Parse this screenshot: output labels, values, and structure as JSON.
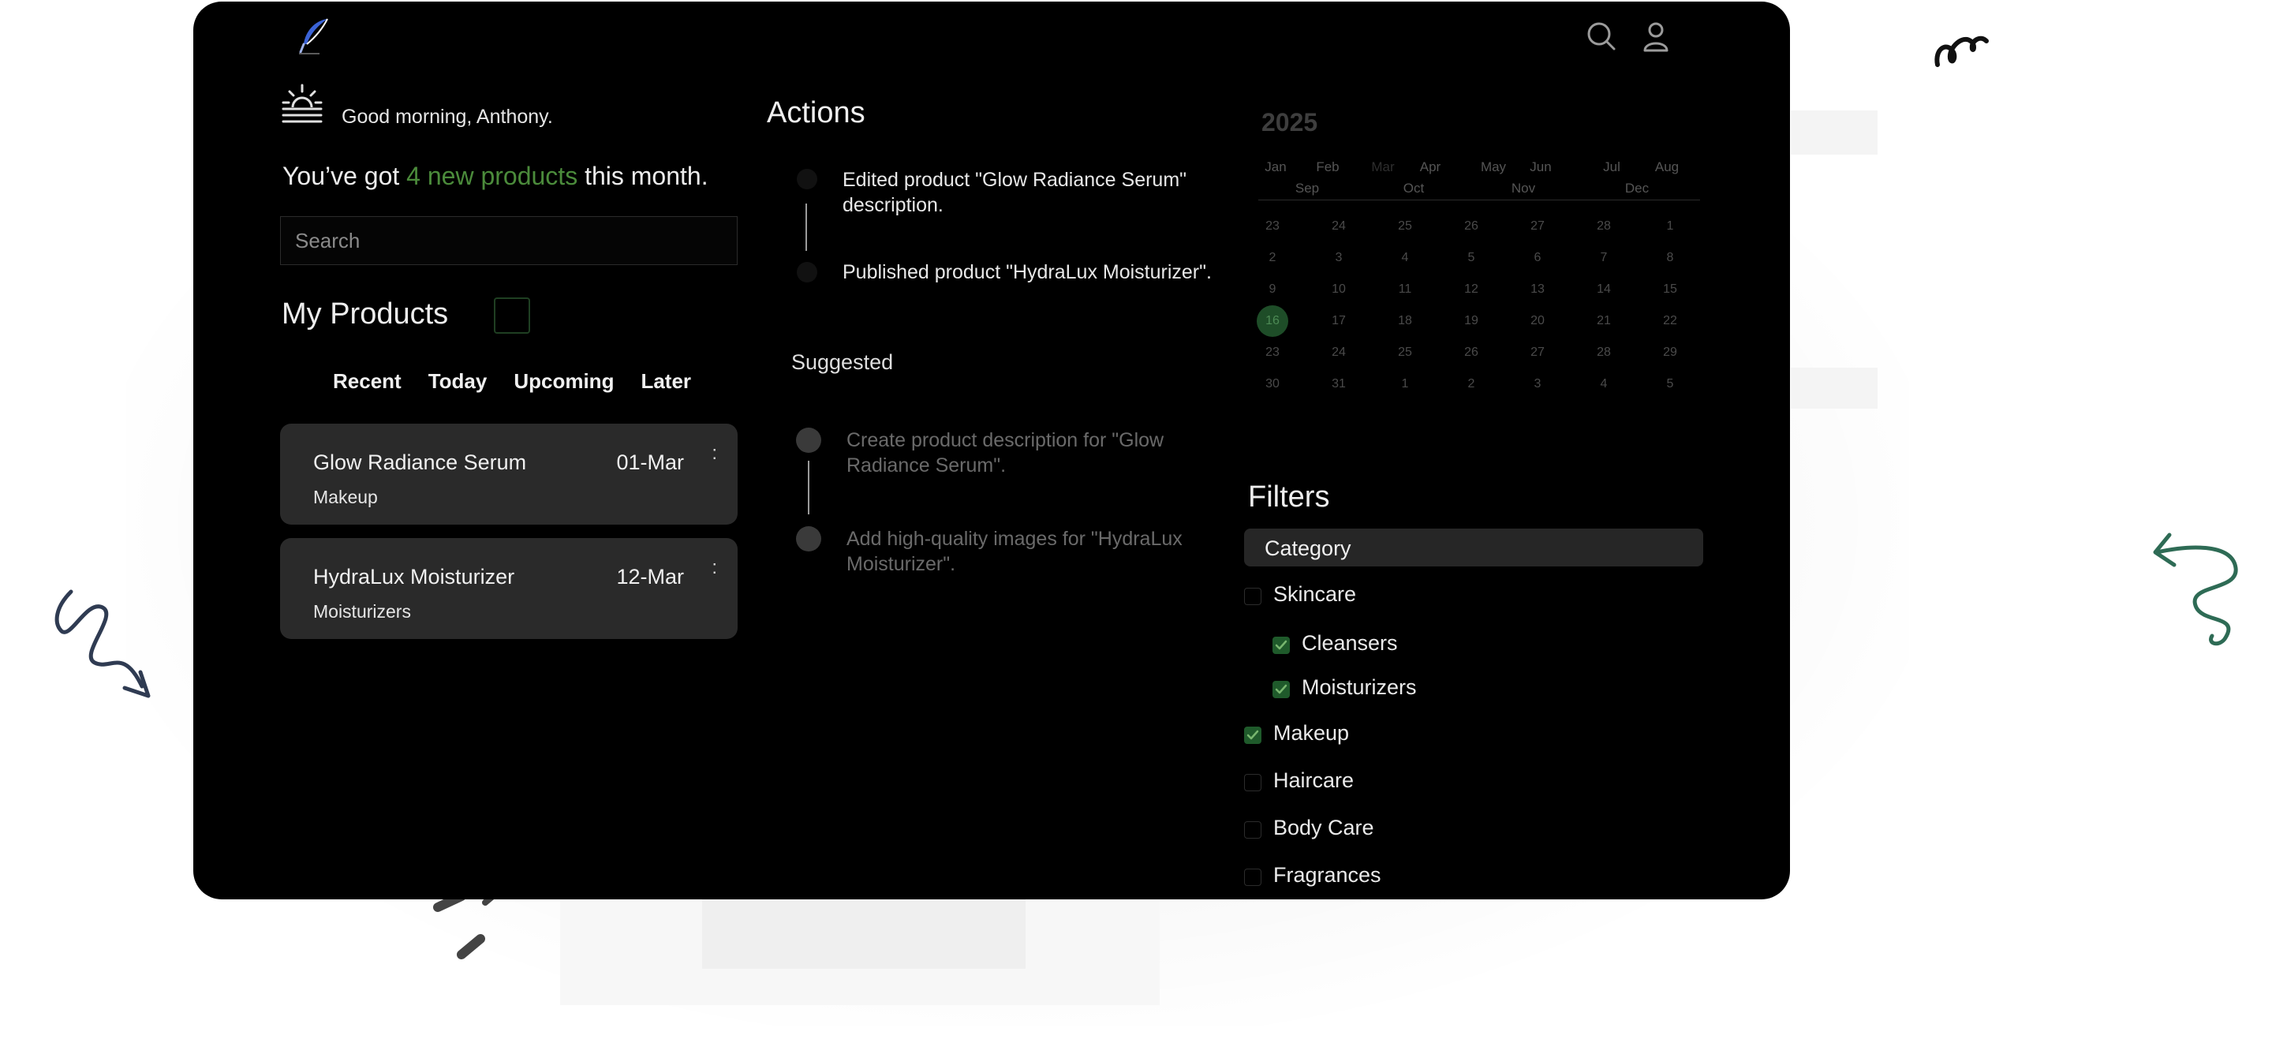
{
  "header": {
    "logo_icon": "feather-quill-icon",
    "search_icon": "search-icon",
    "profile_icon": "user-icon"
  },
  "greeting": {
    "icon": "sunrise-icon",
    "text": "Good morning, Anthony."
  },
  "summary": {
    "prefix": "You’ve got",
    "highlight": "4 new products",
    "suffix": "this month.",
    "highlight_color": "#4b8b3b"
  },
  "search": {
    "placeholder": "Search"
  },
  "products": {
    "title": "My Products",
    "tabs": [
      "Recent",
      "Today",
      "Upcoming",
      "Later"
    ],
    "items": [
      {
        "name": "Glow Radiance Serum",
        "date": "01-Mar",
        "category": "Makeup",
        "menu": ":"
      },
      {
        "name": "HydraLux Moisturizer",
        "date": "12-Mar",
        "category": "Moisturizers",
        "menu": ":"
      }
    ]
  },
  "actions": {
    "title": "Actions",
    "items": [
      "Edited product \"Glow Radiance Serum\" description.",
      "Published product \"HydraLux Moisturizer\"."
    ],
    "suggested_title": "Suggested",
    "suggested": [
      "Create product description for \"Glow Radiance Serum\".",
      "Add high-quality images for \"HydraLux Moisturizer\"."
    ]
  },
  "calendar": {
    "year": "2025",
    "months_row1": [
      "Jan",
      "Feb",
      "Mar",
      "Apr",
      "May",
      "Jun",
      "Jul",
      "Aug"
    ],
    "months_row2": [
      "Sep",
      "Oct",
      "Nov",
      "Dec"
    ],
    "selected_month": "Mar",
    "weeks": [
      [
        "23",
        "24",
        "25",
        "26",
        "27",
        "28",
        "1"
      ],
      [
        "2",
        "3",
        "4",
        "5",
        "6",
        "7",
        "8"
      ],
      [
        "9",
        "10",
        "11",
        "12",
        "13",
        "14",
        "15"
      ],
      [
        "16",
        "17",
        "18",
        "19",
        "20",
        "21",
        "22"
      ],
      [
        "23",
        "24",
        "25",
        "26",
        "27",
        "28",
        "29"
      ],
      [
        "30",
        "31",
        "1",
        "2",
        "3",
        "4",
        "5"
      ]
    ],
    "today": "16"
  },
  "filters": {
    "title": "Filters",
    "category_label": "Category",
    "options": [
      {
        "label": "Skincare",
        "checked": false,
        "indent": false
      },
      {
        "label": "Cleansers",
        "checked": true,
        "indent": true
      },
      {
        "label": "Moisturizers",
        "checked": true,
        "indent": true
      },
      {
        "label": "Makeup",
        "checked": true,
        "indent": false
      },
      {
        "label": "Haircare",
        "checked": false,
        "indent": false
      },
      {
        "label": "Body Care",
        "checked": false,
        "indent": false
      },
      {
        "label": "Fragrances",
        "checked": false,
        "indent": false
      }
    ]
  },
  "colors": {
    "accent": "#4b8b3b",
    "check": "#1f5a2b",
    "card": "#2a2a2a",
    "doodle_green": "#2e6b55",
    "doodle_navy": "#2f3b52"
  }
}
